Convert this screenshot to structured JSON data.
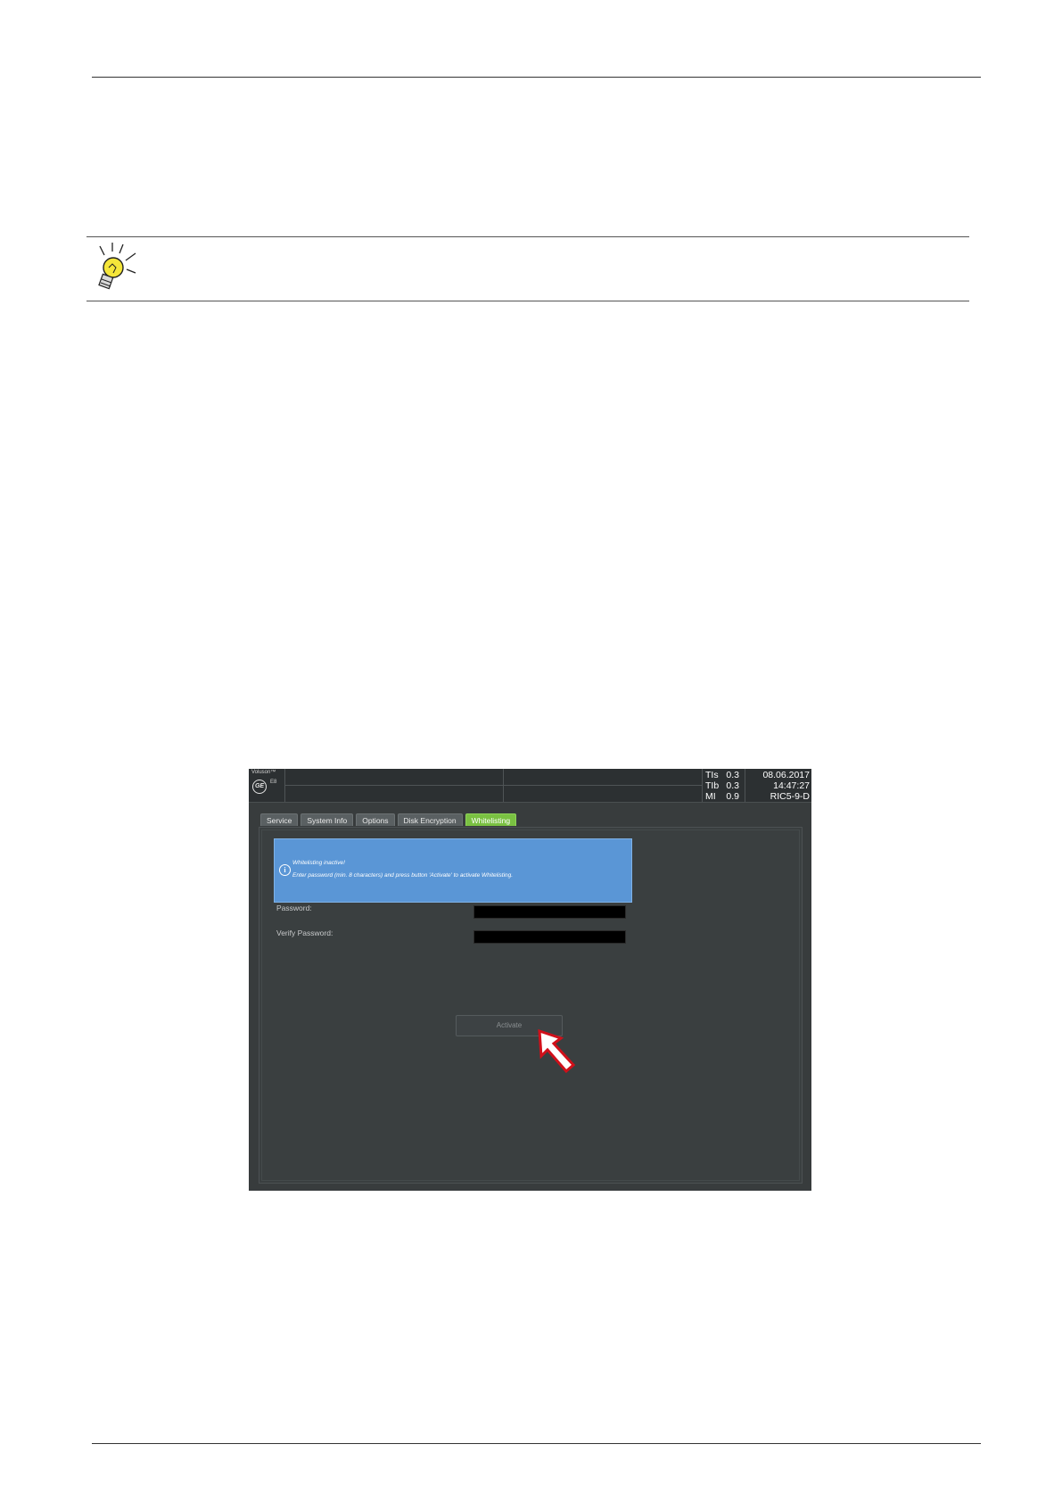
{
  "screenshot": {
    "topbar": {
      "brand": "Voluson™",
      "model": "E8",
      "logo": "GE",
      "indices": [
        {
          "name": "TIs",
          "value": "0.3"
        },
        {
          "name": "TIb",
          "value": "0.3"
        },
        {
          "name": "MI",
          "value": "0.9"
        }
      ],
      "date": "08.06.2017",
      "time": "14:47:27",
      "probe": "RIC5-9-D"
    },
    "tabs": [
      {
        "label": "Service",
        "active": false
      },
      {
        "label": "System Info",
        "active": false
      },
      {
        "label": "Options",
        "active": false
      },
      {
        "label": "Disk Encryption",
        "active": false
      },
      {
        "label": "Whitelisting",
        "active": true
      }
    ],
    "info": {
      "title": "Whitelisting inactive!",
      "text": "Enter password (min. 8 characters) and press button 'Activate' to activate Whitelisting."
    },
    "fields": {
      "password_label": "Password:",
      "password_value": "",
      "verify_label": "Verify Password:",
      "verify_value": ""
    },
    "activate_label": "Activate"
  },
  "colors": {
    "accent_tab": "#7ac142",
    "info_box": "#5a96d6",
    "arrow_fill": "#ffffff",
    "arrow_outline": "#d0101a"
  },
  "icons": [
    "tip-lightbulb-icon",
    "ge-logo",
    "info-icon",
    "pointer-arrow-icon"
  ]
}
